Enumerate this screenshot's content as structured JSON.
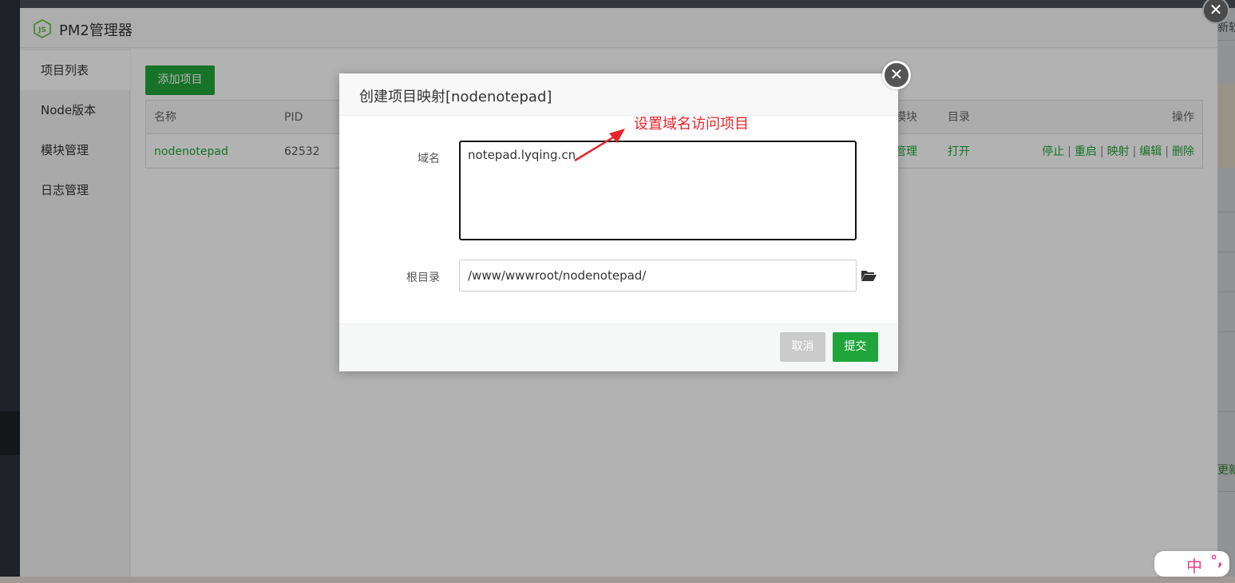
{
  "window": {
    "title": "PM2管理器"
  },
  "sidebar": {
    "items": [
      {
        "label": "项目列表",
        "active": true
      },
      {
        "label": "Node版本",
        "active": false
      },
      {
        "label": "模块管理",
        "active": false
      },
      {
        "label": "日志管理",
        "active": false
      }
    ]
  },
  "toolbar": {
    "add_label": "添加项目"
  },
  "table": {
    "headers": {
      "name": "名称",
      "pid": "PID",
      "module": "模块",
      "directory": "目录",
      "actions": "操作"
    },
    "rows": [
      {
        "name": "nodenotepad",
        "pid": "62532",
        "module": "管理",
        "directory": "打开",
        "actions": {
          "stop": "停止",
          "restart": "重启",
          "map": "映射",
          "edit": "编辑",
          "delete": "删除",
          "separator": "|"
        }
      }
    ]
  },
  "modal": {
    "title": "创建项目映射[nodenotepad]",
    "domain_label": "域名",
    "domain_value": "notepad.lyqing.cn",
    "root_label": "根目录",
    "root_value": "/www/wwwroot/nodenotepad/",
    "cancel_label": "取消",
    "submit_label": "提交",
    "close_glyph": "✕"
  },
  "annotation": {
    "text": "设置域名访问项目",
    "color": "#e8232b"
  },
  "background_fragments": {
    "top_right_text": "新软",
    "bottom_right_text": "更新"
  },
  "outer_close_glyph": "✕",
  "ime": {
    "mode_char": "中",
    "punct_char": "°,"
  },
  "colors": {
    "brand_green": "#20a53a",
    "cancel_gray": "#cbcbcb",
    "ime_pink": "#e0458b"
  }
}
